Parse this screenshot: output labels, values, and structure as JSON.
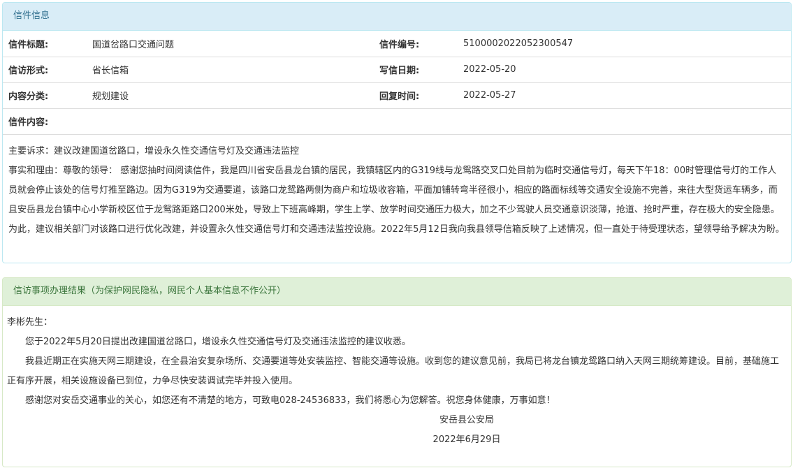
{
  "letter_panel": {
    "heading": "信件信息",
    "rows": [
      {
        "label1": "信件标题:",
        "value1": "国道岔路口交通问题",
        "label2": "信件编号:",
        "value2": "5100002022052300547"
      },
      {
        "label1": "信访形式:",
        "value1": "省长信箱",
        "label2": "写信日期:",
        "value2": "2022-05-20"
      },
      {
        "label1": "内容分类:",
        "value1": "规划建设",
        "label2": "回复时间:",
        "value2": "2022-05-27"
      }
    ],
    "content_label": "信件内容:",
    "appeal": "主要诉求：建议改建国道岔路口，增设永久性交通信号灯及交通违法监控",
    "facts": "事实和理由：尊敬的领导： 感谢您抽时间阅读信件，我是四川省安岳县龙台镇的居民，我镇辖区内的G319线与龙鸳路交叉口处目前为临时交通信号灯，每天下午18：00时管理信号灯的工作人员就会停止该处的信号灯推至路边。因为G319为交通要道，该路口龙鸳路两侧为商户和垃圾收容箱，平面加铺转弯半径很小，相应的路面标线等交通安全设施不完善，来往大型货运车辆多，而且安岳县龙台镇中心小学新校区位于龙鸳路距路口200米处，导致上下班高峰期，学生上学、放学时间交通压力极大，加之不少驾驶人员交通意识淡薄，抢道、抢时严重，存在极大的安全隐患。为此，建议相关部门对该路口进行优化改建，并设置永久性交通信号灯和交通违法监控设施。2022年5月12日我向我县领导信箱反映了上述情况，但一直处于待受理状态，望领导给予解决为盼。"
  },
  "result_panel": {
    "heading": "信访事项办理结果（为保护网民隐私，网民个人基本信息不作公开）",
    "salutation": "李彬先生：",
    "paragraphs": [
      "您于2022年5月20日提出改建国道岔路口，增设永久性交通信号灯及交通违法监控的建议收悉。",
      "我县近期正在实施天网三期建设，在全县治安复杂场所、交通要道等处安装监控、智能交通等设施。收到您的建议意见前，我局已将龙台镇龙鸳路口纳入天网三期统筹建设。目前，基础施工正有序开展，相关设施设备已到位，力争尽快安装调试完毕并投入使用。",
      "感谢您对安岳交通事业的关心，如您还有不清楚的地方，可致电028-24536833，我们将悉心为您解答。祝您身体健康，万事如意！"
    ],
    "signature_org": "安岳县公安局",
    "signature_date": "2022年6月29日"
  }
}
